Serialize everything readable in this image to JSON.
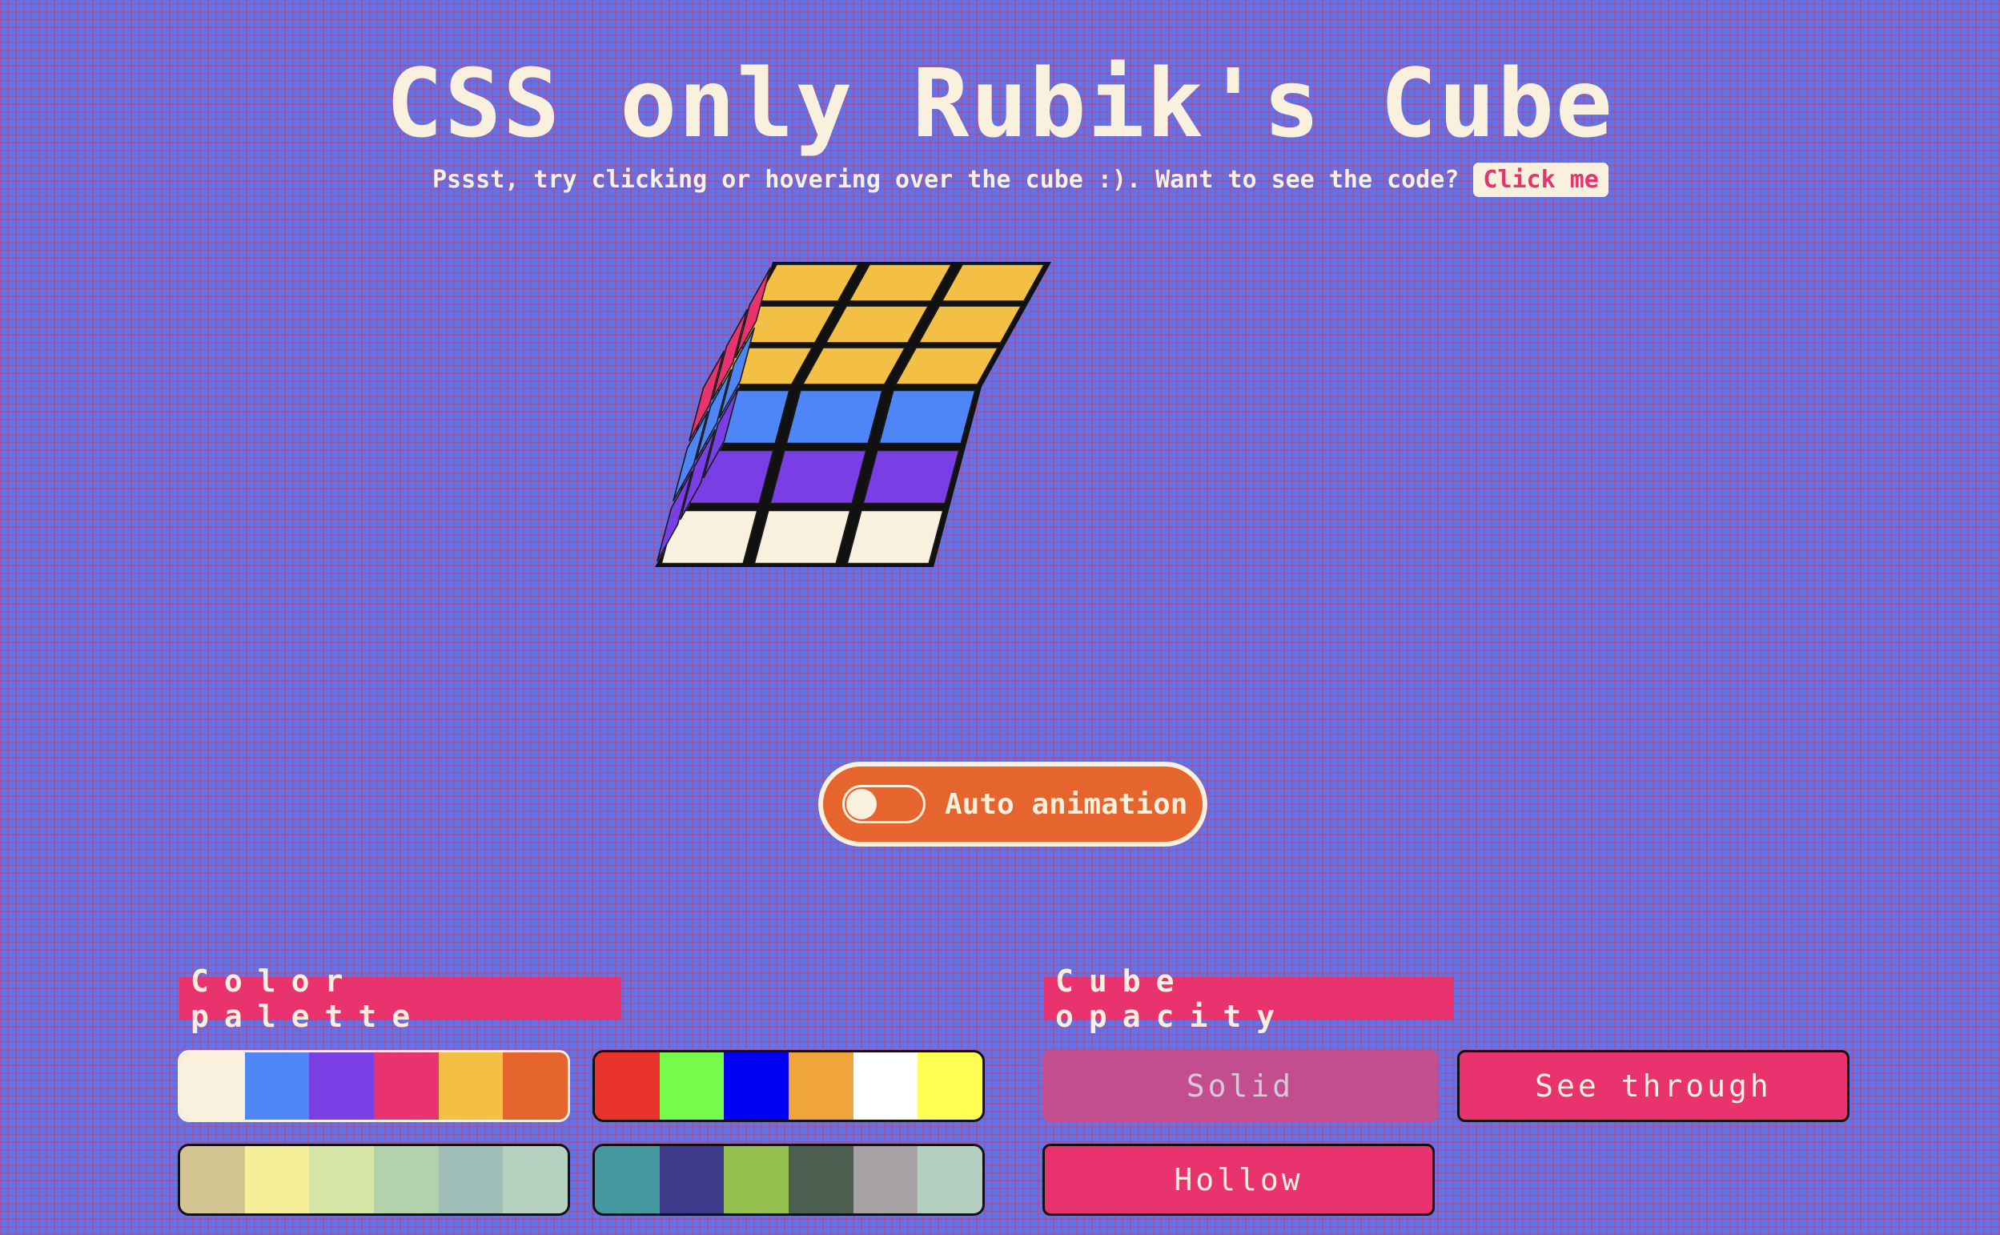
{
  "header": {
    "title": "CSS only Rubik's Cube",
    "subtitle": "Pssst, try clicking or hovering over the cube :). Want to see the code?",
    "code_link": "Click me"
  },
  "cube": {
    "top": "#f3bf45",
    "front": [
      "#4f86f7",
      "#7a3fe4",
      "#faf0de"
    ],
    "left": [
      "#e8336e",
      "#4f86f7",
      "#7a3fe4"
    ]
  },
  "auto_animation": {
    "label": "Auto animation",
    "enabled": false
  },
  "color_palette": {
    "label": "Color palette",
    "palettes": [
      {
        "selected": true,
        "colors": [
          "#faf0de",
          "#4f86f7",
          "#7a3fe4",
          "#e8336e",
          "#f3bf45",
          "#e6652e"
        ]
      },
      {
        "selected": false,
        "colors": [
          "#e8332a",
          "#76fb4c",
          "#0000f5",
          "#efa43c",
          "#ffffff",
          "#ffff54"
        ]
      },
      {
        "selected": false,
        "colors": [
          "#d2c592",
          "#f5ef9a",
          "#d6e4a5",
          "#b1d2ab",
          "#a0beb8",
          "#b6d1c0"
        ]
      },
      {
        "selected": false,
        "colors": [
          "#4699a1",
          "#3e3a8c",
          "#96c151",
          "#4d5f50",
          "#a7a2a5",
          "#b4cebf"
        ]
      }
    ]
  },
  "cube_opacity": {
    "label": "Cube opacity",
    "options": [
      {
        "label": "Solid",
        "active": true
      },
      {
        "label": "See through",
        "active": false
      },
      {
        "label": "Hollow",
        "active": false
      }
    ]
  }
}
